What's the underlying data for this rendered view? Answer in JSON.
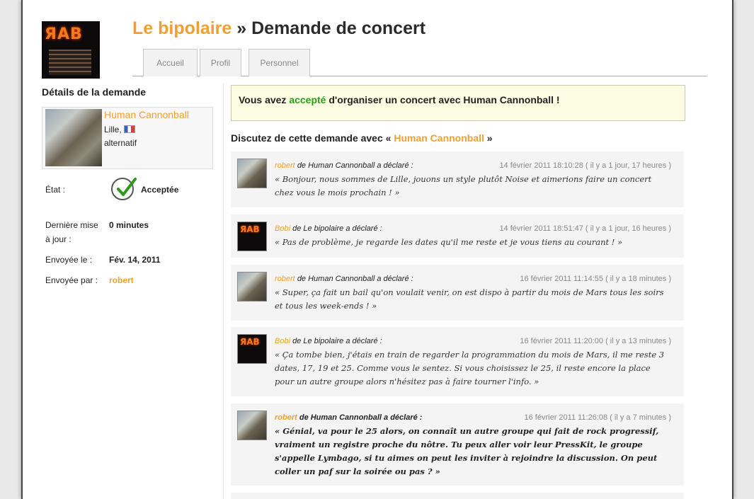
{
  "header": {
    "site_name": "Le bipolaire",
    "separator": "»",
    "page_name": "Demande de concert",
    "logo_text": "ЯAB"
  },
  "tabs": [
    {
      "label": "Accueil"
    },
    {
      "label": "Profil"
    },
    {
      "label": "Personnel"
    }
  ],
  "sidebar": {
    "title": "Détails de la demande",
    "band": {
      "name": "Human Cannonball",
      "city": "Lille,",
      "genre": "alternatif"
    },
    "state_label": "État :",
    "state_value": "Acceptée",
    "last_update_label_1": "Dernière mise",
    "last_update_label_2": "à jour :",
    "last_update_value": "0 minutes",
    "sent_label": "Envoyée le :",
    "sent_value": "Fév. 14, 2011",
    "sent_by_label": "Envoyée par :",
    "sent_by_value": "robert"
  },
  "notice": {
    "before": "Vous avez",
    "status": "accepté",
    "after": "d'organiser un concert avec Human Cannonball !"
  },
  "discussion": {
    "title_before": "Discutez de cette demande avec «",
    "band": "Human Cannonball",
    "title_after": "»"
  },
  "messages": [
    {
      "author": "robert",
      "from": "de Human Cannonball a déclaré :",
      "date": "14 février 2011 18:10:28 ( il y a 1 jour, 17 heures )",
      "text": "« Bonjour, nous sommes de Lille, jouons un style plutôt Noise et aimerions faire un concert chez vous le mois prochain ! »"
    },
    {
      "author": "Bobi",
      "from": "de Le bipolaire a déclaré :",
      "date": "14 février 2011 18:51:47 ( il y a 1 jour, 16 heures )",
      "text": "« Pas de problème, je regarde les dates qu'il me reste et je vous tiens au courant ! »"
    },
    {
      "author": "robert",
      "from": "de Human Cannonball a déclaré :",
      "date": "16 février 2011 11:14:55 ( il y a 18 minutes )",
      "text": "« Super, ça fait un bail qu'on voulait venir, on est dispo à partir du mois de Mars tous les soirs et tous les week-ends ! »"
    },
    {
      "author": "Bobi",
      "from": "de Le bipolaire a déclaré :",
      "date": "16 février 2011 11:20:00 ( il y a 13 minutes )",
      "text": "« Ça tombe bien, j'étais en train de regarder la programmation du mois de Mars, il me reste 3 dates, 17, 19 et 25. Comme vous le sentez. Si vous choisissez le 25, il reste encore la place pour un autre groupe alors n'hésitez pas à faire tourner l'info. »"
    },
    {
      "author": "robert",
      "from": "de Human Cannonball a déclaré :",
      "date": "16 février 2011 11:26:08 ( il y a 7 minutes )",
      "text": "« Génial, va pour le 25 alors, on connaît un autre groupe qui fait de rock progressif, vraiment un registre proche du nôtre. Tu peux aller voir leur PressKit, le groupe s'appelle Lymbago, si tu aimes on peut les inviter à rejoindre la discussion. On peut coller un paf sur la soirée ou pas ? »"
    }
  ],
  "colors": {
    "accent": "#f0a030",
    "accepted": "#2a9a18"
  }
}
